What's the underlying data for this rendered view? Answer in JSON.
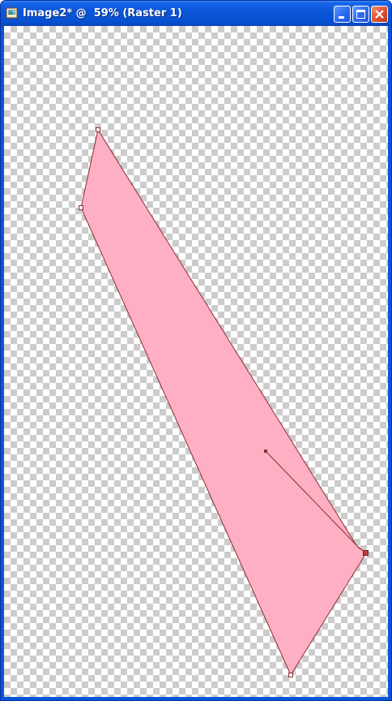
{
  "window": {
    "title": "Image2* @  59% (Raster 1)",
    "icons": {
      "app": "psp-image-icon",
      "minimize": "minimize-icon",
      "maximize": "maximize-icon",
      "close": "close-icon"
    }
  },
  "canvas": {
    "background": "transparency-checkerboard",
    "shape": {
      "type": "polygon",
      "fill_color": "#ffafc3",
      "stroke_color": "#8b2e2e",
      "node_count": 5,
      "control_handle_count": 1
    }
  },
  "colors": {
    "titlebar": "#0a56d8",
    "close_button": "#e0562f",
    "checker_dark": "#cccccc",
    "checker_light": "#ffffff"
  }
}
